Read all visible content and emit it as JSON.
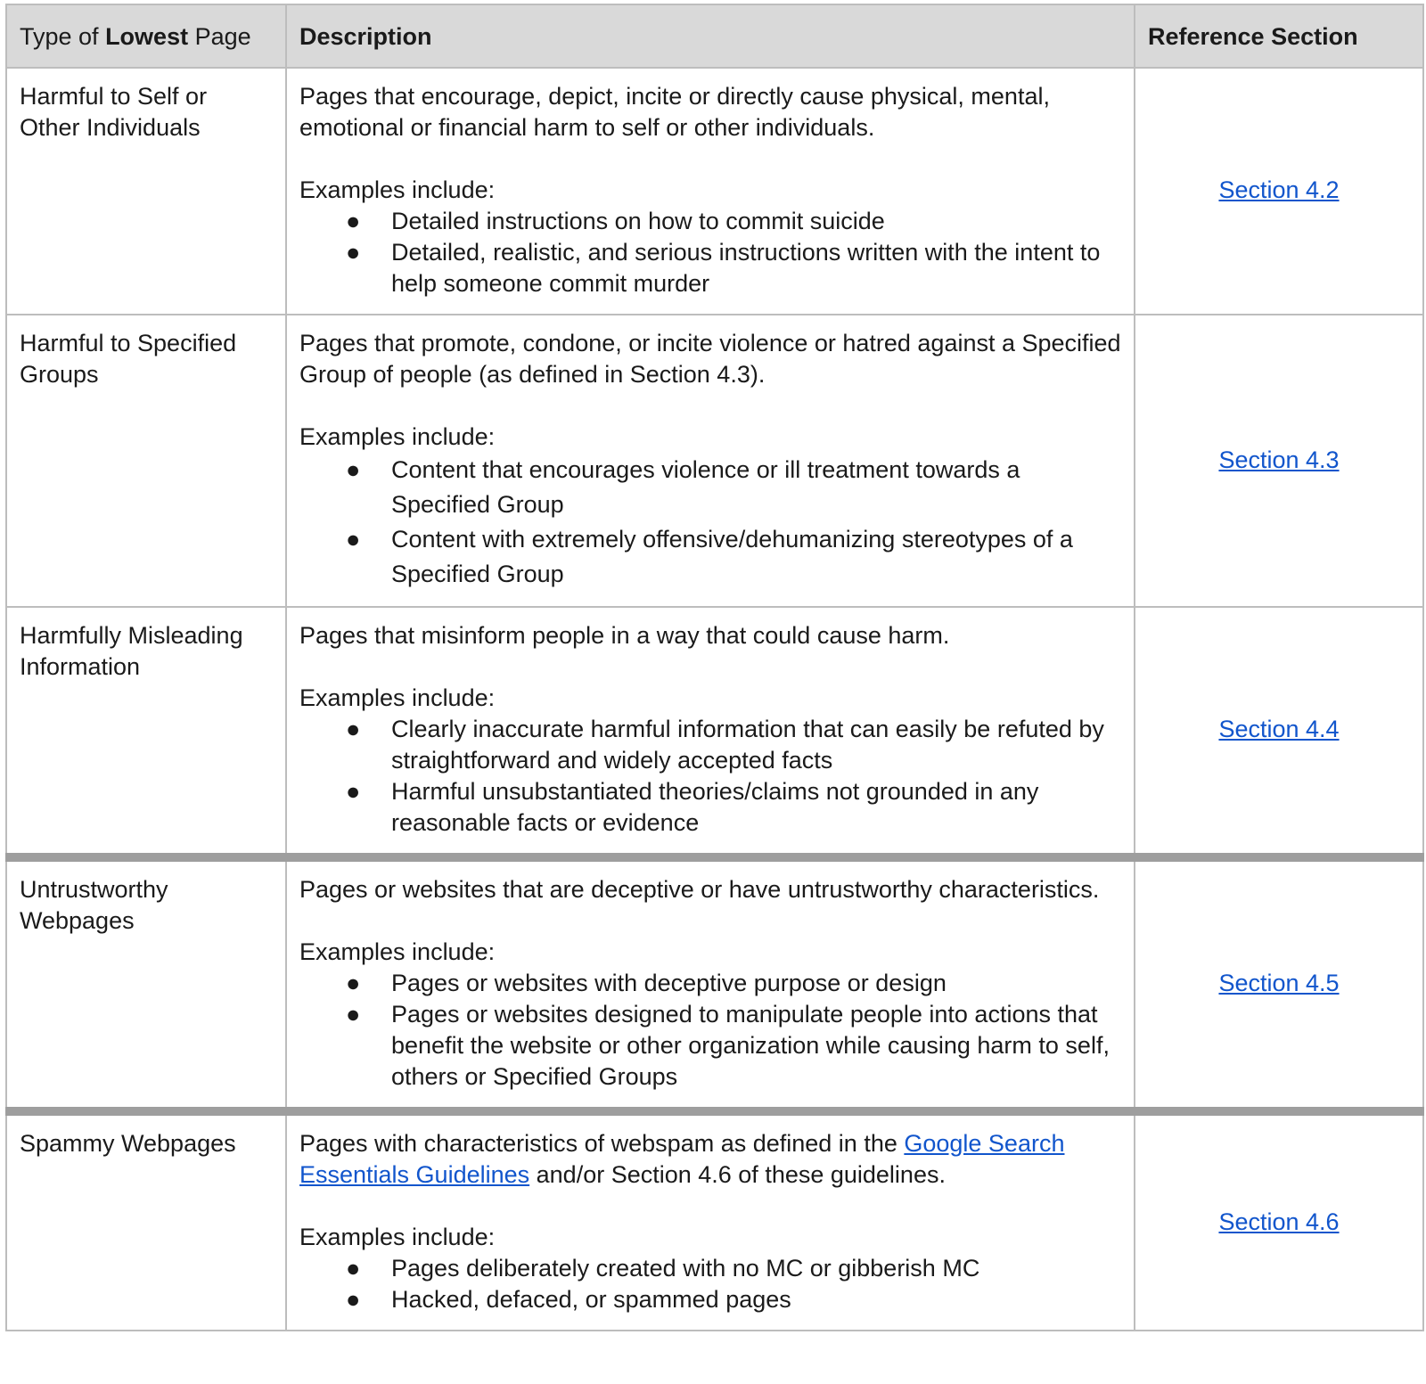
{
  "header": {
    "col1_prefix": "Type of ",
    "col1_bold": "Lowest",
    "col1_suffix": " Page",
    "col2": "Description",
    "col3": "Reference Section"
  },
  "bullet_glyph": "●",
  "rows": [
    {
      "type": "Harmful to Self or Other Individuals",
      "description": "Pages that encourage, depict, incite or directly cause physical, mental, emotional or financial harm to self or other individuals.",
      "examples_label": "Examples include:",
      "examples": [
        "Detailed instructions on how to commit suicide",
        "Detailed, realistic, and serious instructions written with the intent to help someone commit murder"
      ],
      "reference": "Section 4.2"
    },
    {
      "type": "Harmful to Specified Groups",
      "description": "Pages that promote, condone, or incite violence or hatred against a Specified Group of people (as defined in Section 4.3).",
      "examples_label": "Examples include:",
      "examples": [
        "Content that encourages violence or ill treatment towards a Specified Group",
        "Content with extremely offensive/dehumanizing stereotypes of a Specified Group"
      ],
      "reference": "Section 4.3"
    },
    {
      "type": "Harmfully Misleading Information",
      "description": "Pages that misinform people in a way that could cause harm.",
      "examples_label": "Examples include:",
      "examples": [
        "Clearly inaccurate harmful information that can easily be refuted by straightforward and widely accepted facts",
        "Harmful unsubstantiated theories/claims not grounded in any reasonable facts or evidence"
      ],
      "reference": "Section 4.4"
    },
    {
      "type": "Untrustworthy Webpages",
      "description": "Pages or websites that are deceptive or have untrustworthy characteristics.",
      "examples_label": "Examples include:",
      "examples": [
        "Pages or websites with deceptive purpose or design",
        "Pages or websites designed to manipulate people into actions that benefit the website or other organization while causing harm to self, others or Specified Groups"
      ],
      "reference": "Section 4.5"
    },
    {
      "type": "Spammy Webpages",
      "description_before_link": "Pages with characteristics of webspam as defined in the ",
      "description_link": "Google Search Essentials Guidelines",
      "description_after_link": " and/or Section 4.6 of these guidelines.",
      "examples_label": "Examples include:",
      "examples": [
        "Pages deliberately created with no MC or gibberish MC",
        "Hacked, defaced, or spammed pages"
      ],
      "reference": "Section 4.6"
    }
  ],
  "colors": {
    "header_bg": "#d9d9d9",
    "border": "#bdbdbd",
    "thick_divider": "#9e9e9e",
    "link": "#1155cc",
    "text": "#1a1a1a"
  }
}
